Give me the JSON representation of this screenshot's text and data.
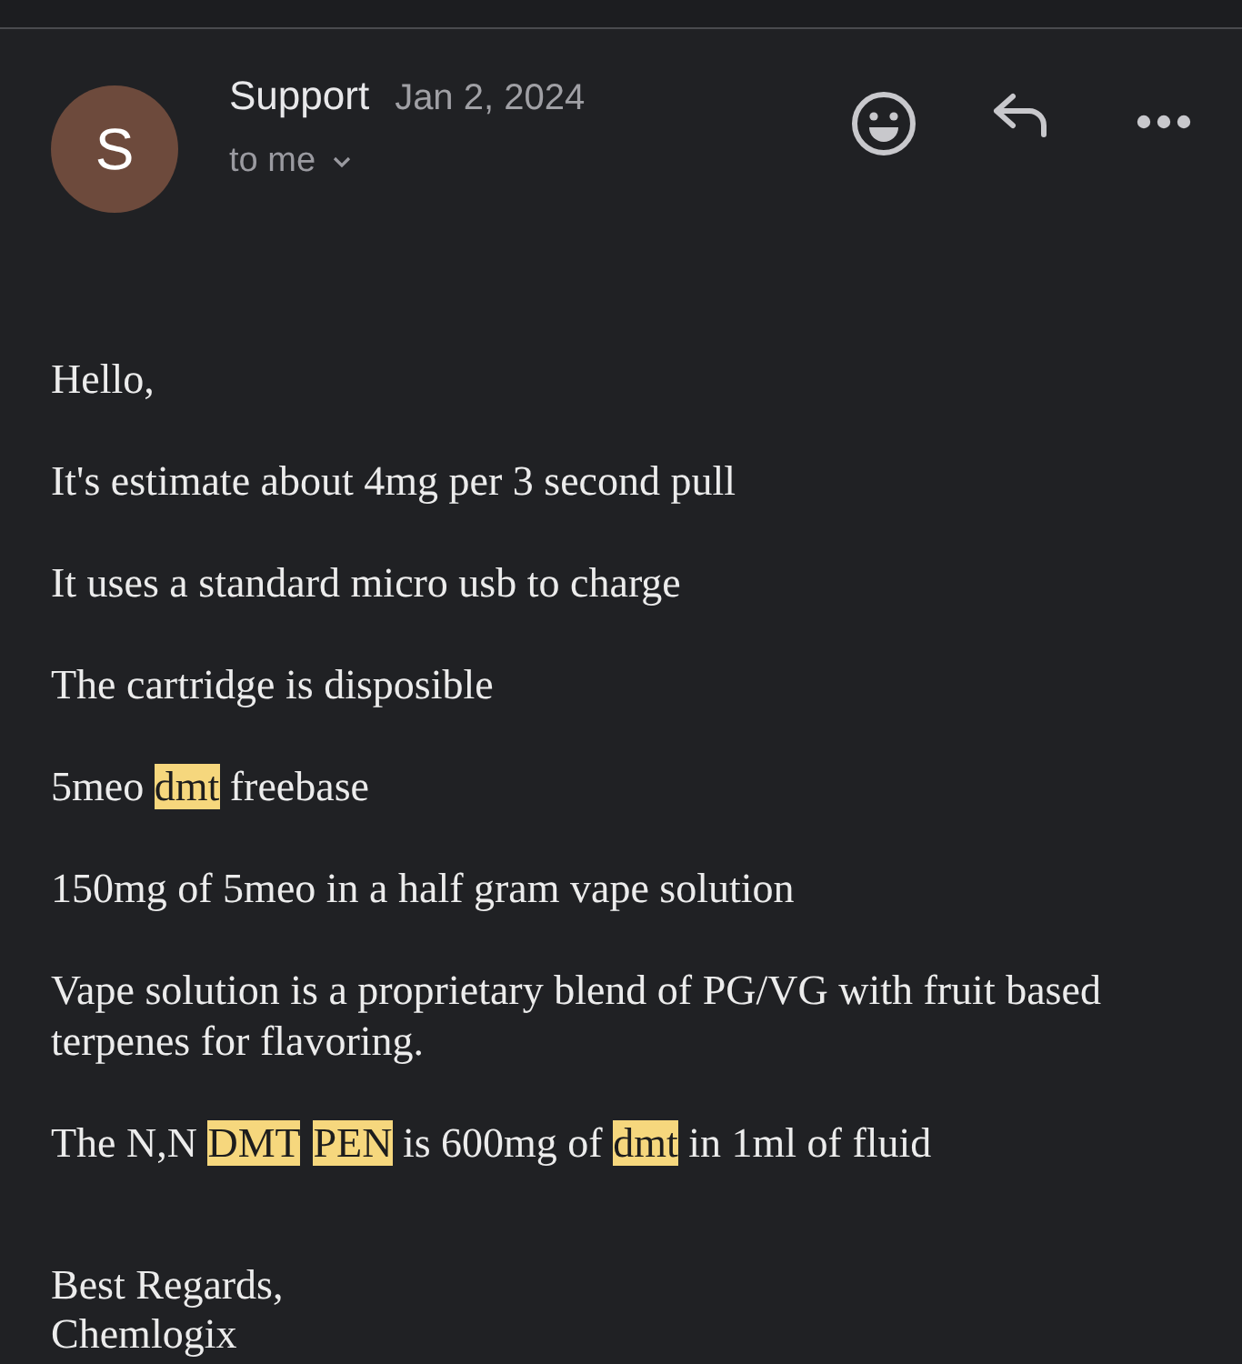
{
  "sender": {
    "avatar_letter": "S",
    "name": "Support",
    "date": "Jan 2, 2024",
    "recipient": "to me"
  },
  "body": [
    [
      {
        "text": "Hello,",
        "highlighted": false
      }
    ],
    [
      {
        "text": "It's estimate about 4mg per 3 second pull",
        "highlighted": false
      }
    ],
    [
      {
        "text": "It uses a standard micro usb to charge",
        "highlighted": false
      }
    ],
    [
      {
        "text": "The cartridge is disposible",
        "highlighted": false
      }
    ],
    [
      {
        "text": "5meo ",
        "highlighted": false
      },
      {
        "text": "dmt",
        "highlighted": true
      },
      {
        "text": " freebase",
        "highlighted": false
      }
    ],
    [
      {
        "text": "150mg of 5meo in a half gram vape solution",
        "highlighted": false
      }
    ],
    [
      {
        "text": "Vape solution is a proprietary blend of PG/VG with fruit based terpenes for flavoring.",
        "highlighted": false
      }
    ],
    [
      {
        "text": "The N,N ",
        "highlighted": false
      },
      {
        "text": "DMT",
        "highlighted": true
      },
      {
        "text": "PEN",
        "highlighted": true
      },
      {
        "text": " is 600mg of ",
        "highlighted": false
      },
      {
        "text": "dmt",
        "highlighted": true
      },
      {
        "text": " in 1ml of fluid",
        "highlighted": false
      }
    ]
  ],
  "signature": [
    "Best Regards,",
    "Chemlogix"
  ]
}
